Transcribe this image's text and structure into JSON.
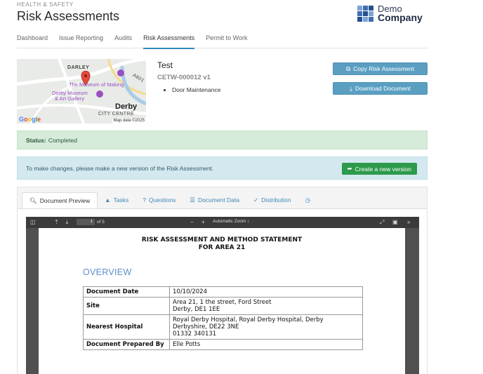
{
  "header": {
    "kicker": "HEALTH & SAFETY",
    "title": "Risk Assessments"
  },
  "logo": {
    "line1": "Demo",
    "line2": "Company",
    "colors": [
      "#7aa3d3",
      "#3f6fb0",
      "#24508f"
    ]
  },
  "nav_tabs": [
    {
      "label": "Dashboard",
      "active": false
    },
    {
      "label": "Issue Reporting",
      "active": false
    },
    {
      "label": "Audits",
      "active": false
    },
    {
      "label": "Risk Assessments",
      "active": true
    },
    {
      "label": "Permit to Work",
      "active": false
    }
  ],
  "map": {
    "district": "DARLEY",
    "road": "A601",
    "poi_1": "The Museum of Making",
    "poi_2_line1": "Derby Museum",
    "poi_2_line2": "& Art Gallery",
    "city": "Derby",
    "city_centre": "CITY CENTRE",
    "attribution": "Google",
    "map_data": "Map data ©2025"
  },
  "assessment": {
    "name": "Test",
    "reference": "CETW-000012 v1",
    "items": [
      "Door Maintenance"
    ]
  },
  "actions": {
    "copy": "Copy Risk Assessment",
    "download": "Download Document"
  },
  "status": {
    "label": "Status:",
    "value": "Completed"
  },
  "notice": {
    "text": "To make changes, please make a new version of the Risk Assessment.",
    "button": "Create a new version"
  },
  "doc_tabs": [
    {
      "label": "Document Preview",
      "icon": "search-icon",
      "active": true
    },
    {
      "label": "Tasks",
      "icon": "warning-icon",
      "active": false
    },
    {
      "label": "Questions",
      "icon": "question-icon",
      "active": false
    },
    {
      "label": "Document Data",
      "icon": "list-icon",
      "active": false
    },
    {
      "label": "Distribution",
      "icon": "check-icon",
      "active": false
    },
    {
      "label": "",
      "icon": "history-icon",
      "active": false
    }
  ],
  "viewer": {
    "page": "1",
    "of_pages": "of 5",
    "zoom": "Automatic Zoom"
  },
  "document": {
    "title_line1": "RISK ASSESSMENT  AND METHOD STATEMENT",
    "title_line2": "FOR AREA 21",
    "section": "OVERVIEW",
    "rows": [
      {
        "key": "Document Date",
        "lines": [
          "10/10/2024"
        ]
      },
      {
        "key": "Site",
        "lines": [
          "Area 21, 1 the street, Ford Street",
          "Derby, DE1 1EE"
        ]
      },
      {
        "key": "Nearest Hospital",
        "lines": [
          "Royal Derby Hospital, Royal Derby Hospital, Derby",
          "Derbyshire, DE22 3NE",
          "01332 340131"
        ]
      },
      {
        "key": "Document Prepared By",
        "lines": [
          "Elle Potts"
        ]
      }
    ]
  }
}
